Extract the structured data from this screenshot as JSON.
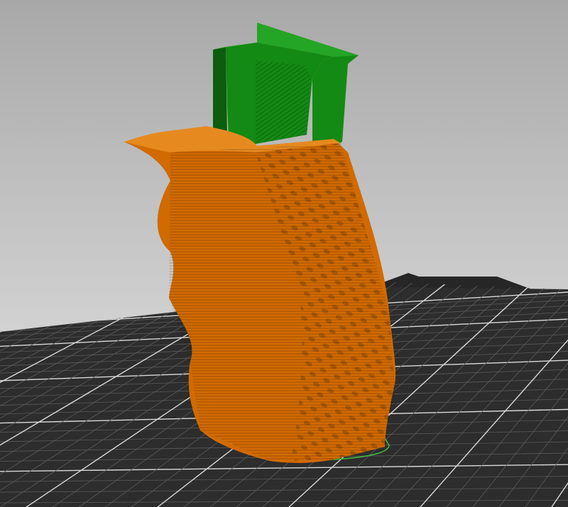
{
  "viewport": {
    "background_top": "#a8a8a8",
    "background_bottom": "#e8e8e8"
  },
  "bed": {
    "surface_color": "#2d2d2d",
    "grid_major_color": "#d9d9d9",
    "grid_minor_color": "#5a5a5a",
    "logo_color": "#262626"
  },
  "objects": [
    {
      "name": "grip",
      "color": "#d16a00",
      "shade_color": "#8c4400",
      "highlight_color": "#e68a1f",
      "selected_outline_color": "#41c041"
    },
    {
      "name": "support-block",
      "color": "#138a13",
      "shade_color": "#0b5e0b",
      "highlight_color": "#25a525"
    }
  ]
}
